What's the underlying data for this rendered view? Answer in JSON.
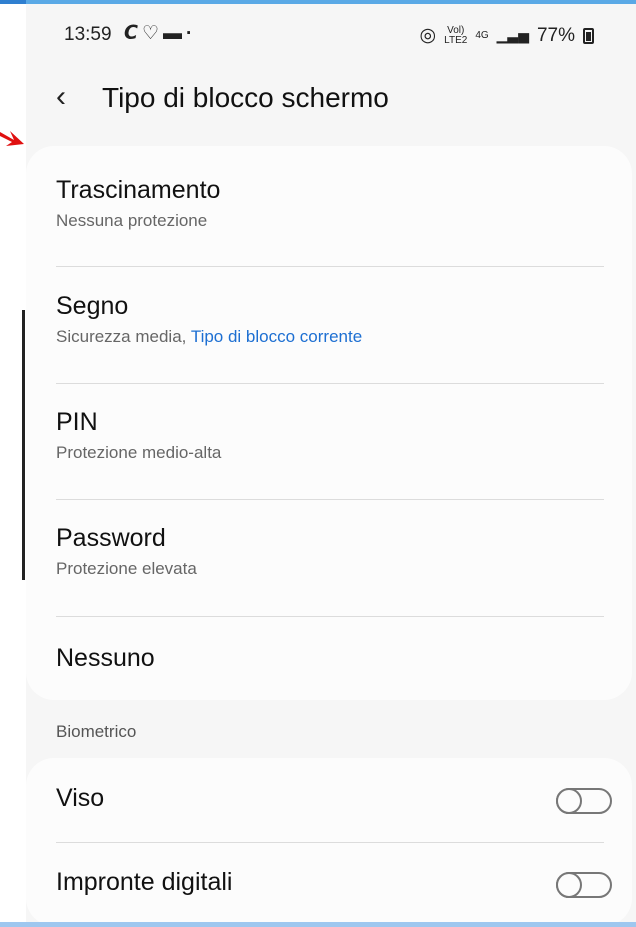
{
  "status_bar": {
    "time": "13:59",
    "left_icons": [
      "c-icon",
      "health-icon",
      "message-icon",
      "dot"
    ],
    "vol_label": "Vol)\nLTE2",
    "net_label": "4G",
    "battery": "77%"
  },
  "header": {
    "title": "Tipo di blocco schermo"
  },
  "lock_types": [
    {
      "label": "Trascinamento",
      "sub": "Nessuna protezione"
    },
    {
      "label": "Segno",
      "sub": "Sicurezza media, ",
      "sub_accent": "Tipo di blocco corrente"
    },
    {
      "label": "PIN",
      "sub": "Protezione medio-alta"
    },
    {
      "label": "Password",
      "sub": "Protezione elevata"
    },
    {
      "label": "Nessuno"
    }
  ],
  "biometrics": {
    "section_label": "Biometrico",
    "items": [
      {
        "label": "Viso",
        "enabled": false
      },
      {
        "label": "Impronte digitali",
        "enabled": false
      }
    ]
  },
  "colors": {
    "accent": "#1d6fd2",
    "annotation_arrow": "#e01010"
  }
}
